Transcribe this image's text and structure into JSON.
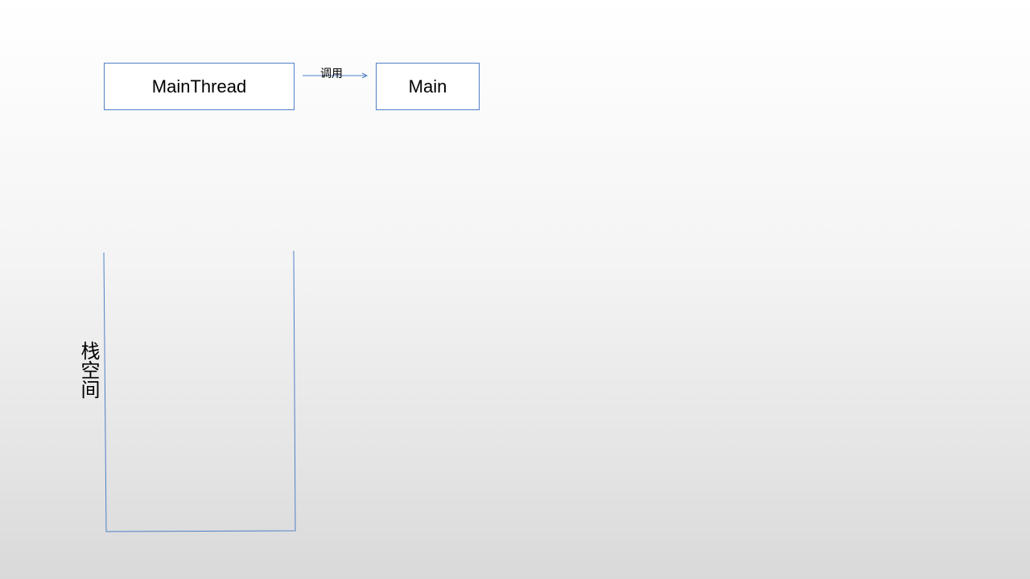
{
  "diagram": {
    "nodes": [
      {
        "id": "mainthread",
        "label": "MainThread"
      },
      {
        "id": "main",
        "label": "Main"
      }
    ],
    "edge": {
      "from": "mainthread",
      "to": "main",
      "label": "调用"
    },
    "stack": {
      "label": "栈空间"
    },
    "colors": {
      "stroke": "#4f7fc6",
      "text": "#000000"
    }
  }
}
